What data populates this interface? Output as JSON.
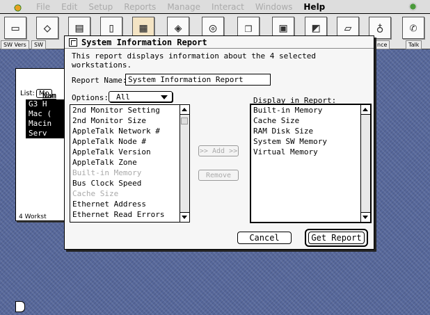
{
  "menubar": {
    "items": [
      "File",
      "Edit",
      "Setup",
      "Reports",
      "Manage",
      "Interact",
      "Windows",
      "Help"
    ],
    "active_item": "Help"
  },
  "toolbar": {
    "icons": [
      "workstation-icon",
      "network-icon",
      "report-icon",
      "document-icon",
      "package-icon",
      "share-icon",
      "speaker-icon",
      "copy-icon",
      "folder-icon",
      "monitor-icon",
      "share-window-icon",
      "gear-icon",
      "phone-icon"
    ],
    "labels": {
      "sw_vers": "SW Vers",
      "sw": "SW",
      "performance": "nce",
      "talk": "Talk"
    }
  },
  "background_window": {
    "list_label": "List:",
    "list_button": "Mo",
    "name_header": "Nam",
    "rows": [
      "G3 H",
      "Mac (",
      "Macin",
      "Serv"
    ],
    "count_text": "4 Workst"
  },
  "dialog": {
    "title": "System Information Report",
    "description": "This report displays information about the 4 selected workstations.",
    "report_name_label": "Report Name:",
    "report_name_value": "System Information Report",
    "options_label": "Options:",
    "options_value": "All",
    "display_label": "Display in Report:",
    "available_items": [
      {
        "label": "2nd Monitor Setting",
        "enabled": true
      },
      {
        "label": "2nd Monitor Size",
        "enabled": true
      },
      {
        "label": "AppleTalk Network #",
        "enabled": true
      },
      {
        "label": "AppleTalk Node #",
        "enabled": true
      },
      {
        "label": "AppleTalk Version",
        "enabled": true
      },
      {
        "label": "AppleTalk Zone",
        "enabled": true
      },
      {
        "label": "Built-in Memory",
        "enabled": false
      },
      {
        "label": "Bus Clock Speed",
        "enabled": true
      },
      {
        "label": "Cache Size",
        "enabled": false
      },
      {
        "label": "Ethernet Address",
        "enabled": true
      },
      {
        "label": "Ethernet Read Errors",
        "enabled": true
      }
    ],
    "display_items": [
      "Built-in Memory",
      "Cache Size",
      "RAM Disk Size",
      "System SW Memory",
      "Virtual Memory"
    ],
    "add_label": ">> Add >>",
    "remove_label": "Remove",
    "cancel_label": "Cancel",
    "get_report_label": "Get Report"
  }
}
